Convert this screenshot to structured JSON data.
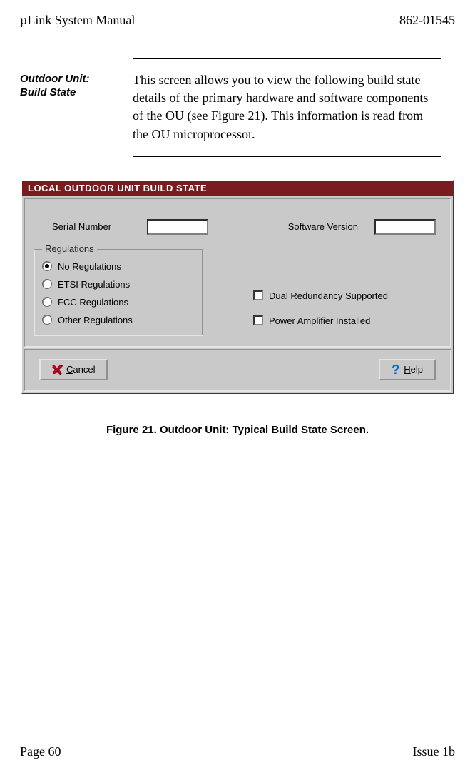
{
  "header": {
    "left": "µLink System Manual",
    "right": "862-01545"
  },
  "sidebar": {
    "heading_line1": "Outdoor Unit:",
    "heading_line2": "Build State"
  },
  "paragraph": "This screen allows you to view the following build state details of the primary hardware and software components of the OU (see Figure 21).  This information is read from the OU microprocessor.",
  "dialog": {
    "title": "LOCAL OUTDOOR UNIT BUILD STATE",
    "serial_label": "Serial Number",
    "software_label": "Software Version",
    "serial_value": "",
    "software_value": "",
    "regulations_legend": "Regulations",
    "radios": {
      "none": "No Regulations",
      "etsi": "ETSI Regulations",
      "fcc": "FCC Regulations",
      "other": "Other Regulations"
    },
    "checks": {
      "dual": "Dual Redundancy Supported",
      "pa": "Power Amplifier Installed"
    },
    "buttons": {
      "cancel": "ancel",
      "cancel_accel": "C",
      "help": "elp",
      "help_accel": "H"
    }
  },
  "caption": "Figure 21.  Outdoor Unit:  Typical Build State Screen.",
  "footer": {
    "left": "Page 60",
    "right": "Issue 1b"
  }
}
